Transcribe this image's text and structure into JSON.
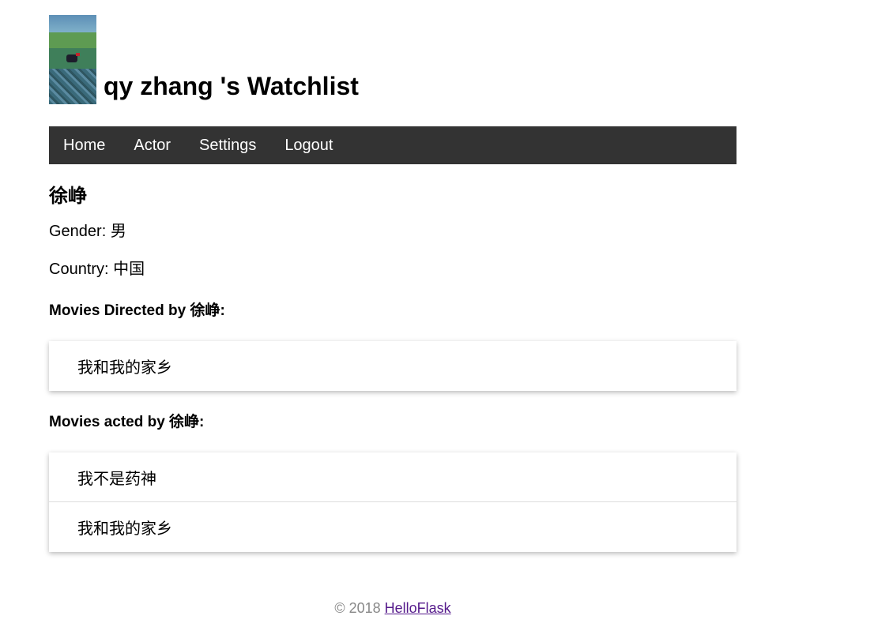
{
  "header": {
    "title": "qy zhang 's Watchlist"
  },
  "nav": {
    "items": [
      "Home",
      "Actor",
      "Settings",
      "Logout"
    ]
  },
  "actor": {
    "name": "徐峥",
    "gender_label": "Gender:",
    "gender": "男",
    "country_label": "Country:",
    "country": "中国"
  },
  "directed": {
    "heading": "Movies Directed by 徐峥:",
    "movies": [
      "我和我的家乡"
    ]
  },
  "acted": {
    "heading": "Movies acted by 徐峥:",
    "movies": [
      "我不是药神",
      "我和我的家乡"
    ]
  },
  "footer": {
    "copyright": "© 2018",
    "link": "HelloFlask"
  },
  "colors": {
    "nav_bg": "#333333",
    "link_visited": "#551a8b",
    "footer_text": "#888888"
  }
}
